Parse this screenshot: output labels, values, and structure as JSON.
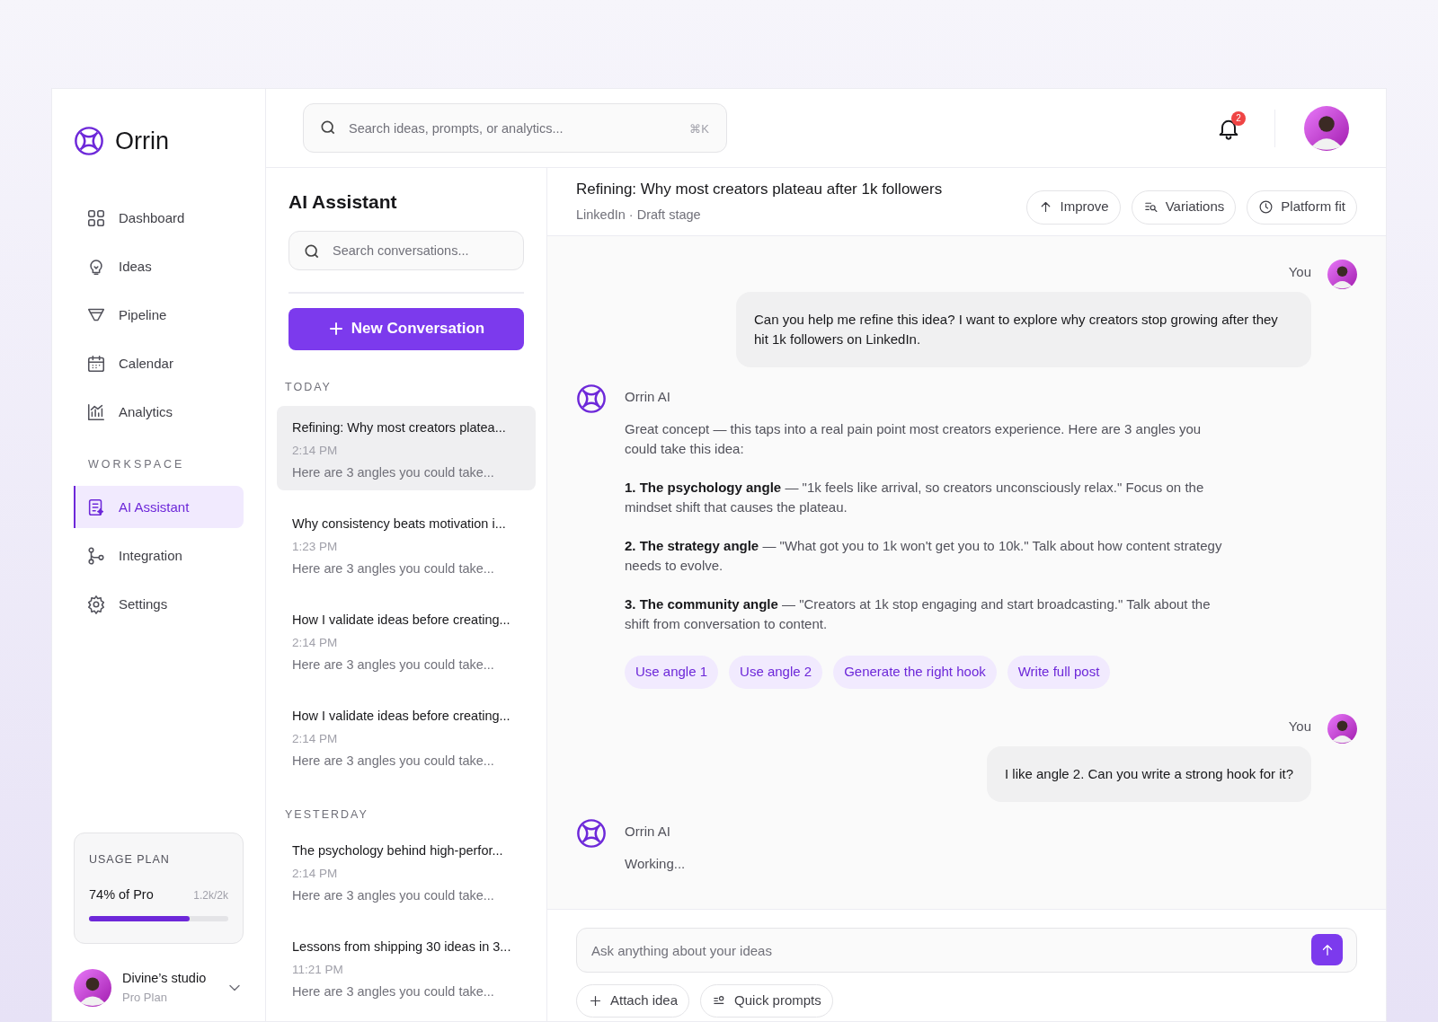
{
  "brand": {
    "name": "Orrin"
  },
  "nav": [
    {
      "label": "Dashboard",
      "selected": false
    },
    {
      "label": "Ideas",
      "selected": false
    },
    {
      "label": "Pipeline",
      "selected": false
    },
    {
      "label": "Calendar",
      "selected": false
    },
    {
      "label": "Analytics",
      "selected": false
    }
  ],
  "workspace": {
    "heading": "WORKSPACE",
    "items": [
      {
        "label": "AI Assistant",
        "selected": true
      },
      {
        "label": "Integration",
        "selected": false
      },
      {
        "label": "Settings",
        "selected": false
      }
    ]
  },
  "usage": {
    "heading": "USAGE PLAN",
    "label": "74% of Pro",
    "count": "1.2k/2k",
    "level": 0.72
  },
  "account": {
    "name": "Divine’s studio",
    "plan": "Pro Plan"
  },
  "topbar": {
    "search": {
      "placeholder": "Search ideas, prompts, or analytics...",
      "shortcut": "⌘K"
    },
    "notifications": "2"
  },
  "conversations": {
    "title": "AI Assistant",
    "search": {
      "placeholder": "Search conversations..."
    },
    "new_button": "New Conversation",
    "groups": [
      {
        "heading": "TODAY",
        "items": [
          {
            "title": "Refining: Why most creators platea...",
            "time": "2:14 PM",
            "preview": "Here are 3 angles you could take...",
            "selected": true
          },
          {
            "title": "Why consistency beats motivation i...",
            "time": "1:23 PM",
            "preview": "Here are 3 angles you could take...",
            "selected": false
          },
          {
            "title": "How I validate ideas before creating...",
            "time": "2:14 PM",
            "preview": "Here are 3 angles you could take...",
            "selected": false
          },
          {
            "title": "How I validate ideas before creating...",
            "time": "2:14 PM",
            "preview": "Here are 3 angles you could take...",
            "selected": false
          }
        ]
      },
      {
        "heading": "YESTERDAY",
        "items": [
          {
            "title": "The psychology behind high-perfor...",
            "time": "2:14 PM",
            "preview": "Here are 3 angles you could take...",
            "selected": false
          },
          {
            "title": "Lessons from shipping 30 ideas in 3...",
            "time": "11:21 PM",
            "preview": "Here are 3 angles you could take...",
            "selected": false
          }
        ]
      }
    ]
  },
  "chat": {
    "title": "Refining: Why most creators plateau after 1k followers",
    "subtitle": "LinkedIn · Draft stage",
    "actions": [
      "Improve",
      "Variations",
      "Platform fit"
    ],
    "messages": [
      {
        "kind": "user",
        "author": "You",
        "text": "Can you help me refine this idea? I want to explore why creators stop growing after they hit 1k followers on LinkedIn."
      },
      {
        "kind": "assistant",
        "author": "Orrin AI",
        "paragraphs": [
          "Great concept — this taps into a real pain point most creators experience. Here are 3 angles you could take this idea:",
          "**1. The psychology angle** — \"1k feels like arrival, so creators unconsciously relax.\" Focus on the mindset shift that causes the plateau.",
          "**2. The strategy angle** — \"What got you to 1k won't get you to 10k.\" Talk about how content strategy needs to evolve.",
          "**3. The community angle** — \"Creators at 1k stop engaging and start broadcasting.\" Talk about the shift from conversation to content."
        ],
        "chips": [
          "Use angle 1",
          "Use angle 2",
          "Generate the right hook",
          "Write full post"
        ]
      },
      {
        "kind": "user",
        "author": "You",
        "text": "I like angle 2. Can you write a strong hook for it?"
      },
      {
        "kind": "assistant",
        "author": "Orrin AI",
        "paragraphs": [
          "Working..."
        ]
      }
    ],
    "composer": {
      "placeholder": "Ask anything about your ideas",
      "tools": [
        "Attach idea",
        "Quick prompts"
      ]
    }
  }
}
